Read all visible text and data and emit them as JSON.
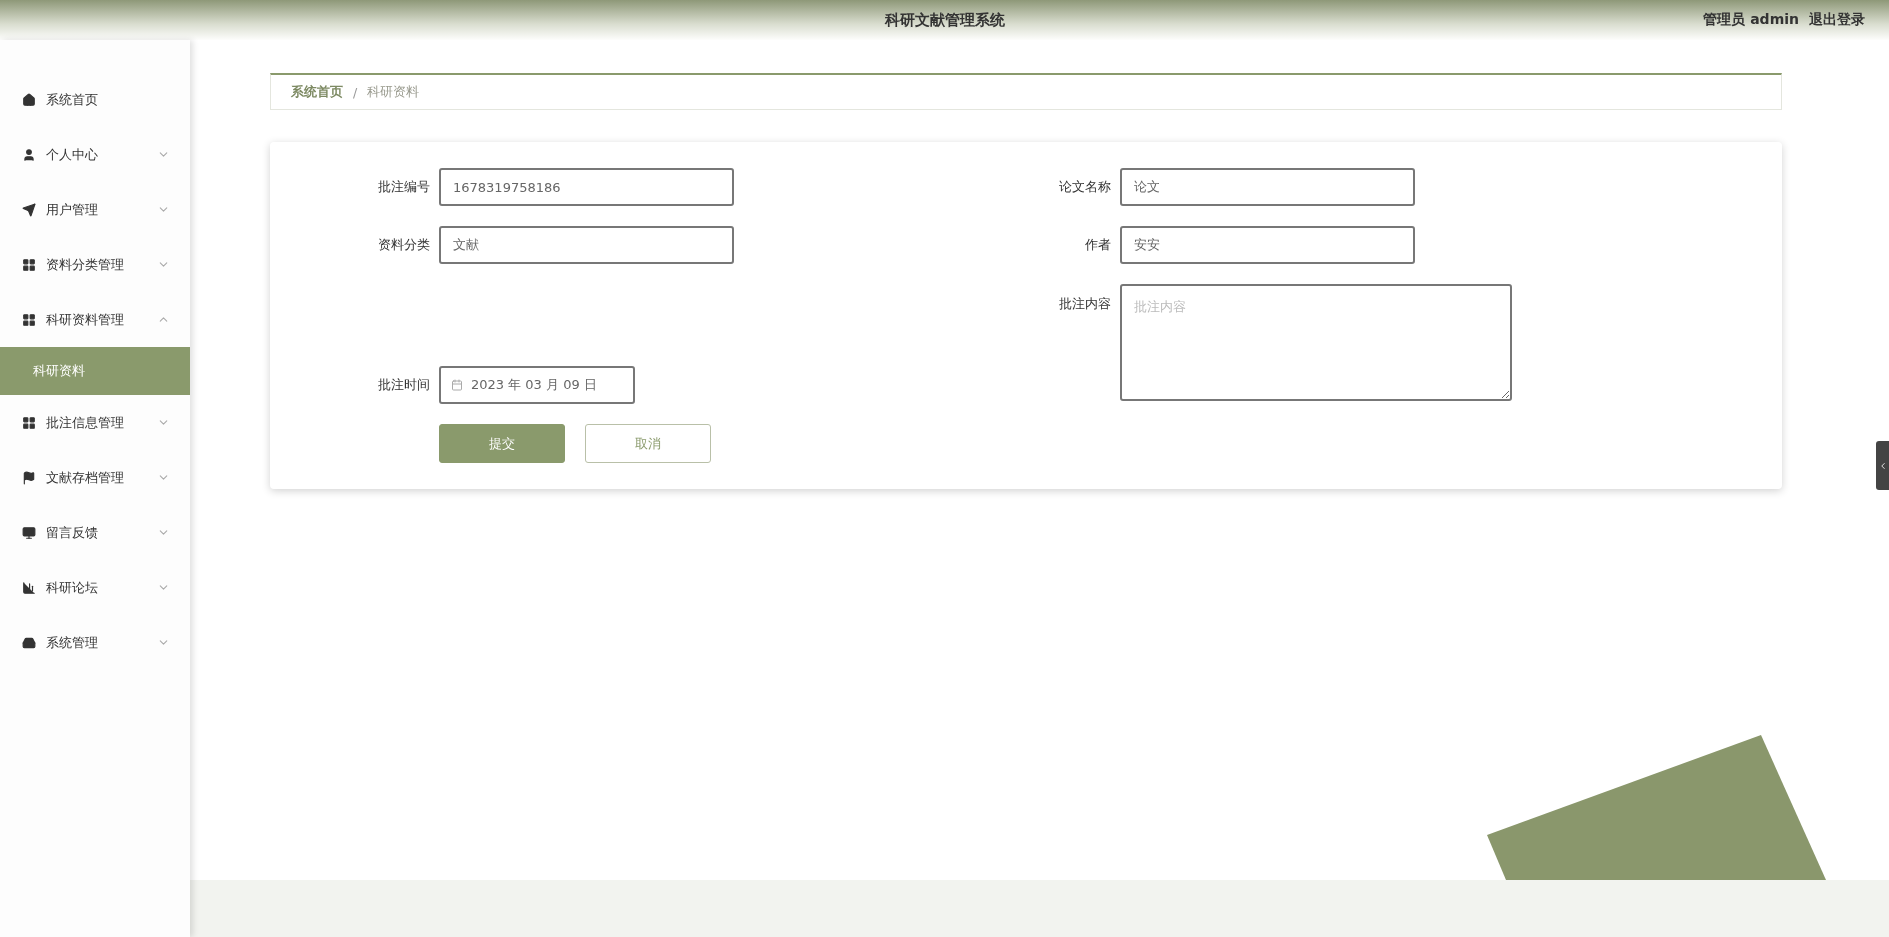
{
  "header": {
    "title": "科研文献管理系统",
    "user": "管理员 admin",
    "logout": "退出登录"
  },
  "sidebar": {
    "items": [
      {
        "label": "系统首页",
        "kind": "link"
      },
      {
        "label": "个人中心",
        "kind": "menu",
        "expanded": false
      },
      {
        "label": "用户管理",
        "kind": "menu",
        "expanded": false
      },
      {
        "label": "资料分类管理",
        "kind": "menu",
        "expanded": false
      },
      {
        "label": "科研资料管理",
        "kind": "menu",
        "expanded": true,
        "children": [
          {
            "label": "科研资料",
            "selected": true
          }
        ]
      },
      {
        "label": "批注信息管理",
        "kind": "menu",
        "expanded": false
      },
      {
        "label": "文献存档管理",
        "kind": "menu",
        "expanded": false
      },
      {
        "label": "留言反馈",
        "kind": "menu",
        "expanded": false
      },
      {
        "label": "科研论坛",
        "kind": "menu",
        "expanded": false
      },
      {
        "label": "系统管理",
        "kind": "menu",
        "expanded": false
      }
    ]
  },
  "breadcrumb": {
    "separator": "/",
    "items": [
      "系统首页",
      "科研资料"
    ]
  },
  "form": {
    "left": [
      {
        "kind": "text",
        "label": "批注编号",
        "value": "1678319758186"
      },
      {
        "kind": "text",
        "label": "资料分类",
        "value": "文献"
      },
      {
        "kind": "date",
        "label": "批注时间",
        "value": "2023 年 03 月 09 日"
      }
    ],
    "right": [
      {
        "kind": "text",
        "label": "论文名称",
        "value": "论文"
      },
      {
        "kind": "text",
        "label": "作者",
        "value": "安安"
      },
      {
        "kind": "textarea",
        "label": "批注内容",
        "placeholder": "批注内容"
      }
    ],
    "buttons": [
      {
        "kind": "primary",
        "label": "提交"
      },
      {
        "kind": "secondary",
        "label": "取消"
      }
    ]
  }
}
